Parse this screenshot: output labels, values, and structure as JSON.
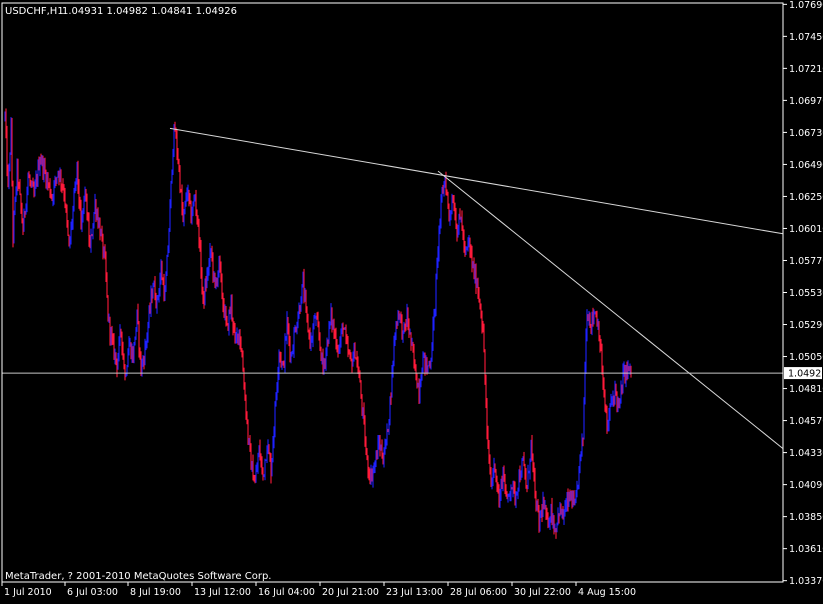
{
  "header": {
    "symbol_label": "USDCHF,H1",
    "ohlc_values": "1.04931 1.04982 1.04841 1.04926"
  },
  "footer": {
    "copyright": "MetaTrader, ? 2001-2010 MetaQuotes Software Corp."
  },
  "colors": {
    "background": "#000000",
    "bull_candle": "#1e22ff",
    "bear_candle": "#ff1a3a",
    "axis": "#ffffff",
    "trendline": "#d8d8d8",
    "bid_line": "#c8c8c8",
    "price_tag_bg": "#ffffff",
    "price_tag_text": "#000000"
  },
  "chart_data": {
    "type": "candlestick",
    "symbol": "USDCHF",
    "timeframe": "H1",
    "last_price": "1.04926",
    "x_tick_labels": [
      "1 Jul 2010",
      "6 Jul 03:00",
      "8 Jul 19:00",
      "13 Jul 12:00",
      "16 Jul 04:00",
      "20 Jul 21:00",
      "23 Jul 13:00",
      "28 Jul 06:00",
      "30 Jul 22:00",
      "4 Aug 15:00"
    ],
    "y_tick_labels": [
      "1.07690",
      "1.07450",
      "1.07210",
      "1.06970",
      "1.06730",
      "1.06490",
      "1.06250",
      "1.06010",
      "1.05770",
      "1.05530",
      "1.05290",
      "1.05050",
      "1.04810",
      "1.04570",
      "1.04330",
      "1.04090",
      "1.03850",
      "1.03610",
      "1.03370"
    ],
    "ylim": [
      1.0336,
      1.077
    ],
    "close_path": [
      [
        0,
        1.0685
      ],
      [
        3,
        1.063
      ],
      [
        6,
        1.0675
      ],
      [
        8,
        1.0595
      ],
      [
        12,
        1.0645
      ],
      [
        18,
        1.06
      ],
      [
        23,
        1.064
      ],
      [
        29,
        1.0625
      ],
      [
        35,
        1.0655
      ],
      [
        41,
        1.064
      ],
      [
        47,
        1.0625
      ],
      [
        53,
        1.0645
      ],
      [
        59,
        1.063
      ],
      [
        64,
        1.0585
      ],
      [
        68,
        1.0615
      ],
      [
        72,
        1.0645
      ],
      [
        76,
        1.06
      ],
      [
        80,
        1.063
      ],
      [
        85,
        1.0585
      ],
      [
        90,
        1.062
      ],
      [
        95,
        1.06
      ],
      [
        100,
        1.0575
      ],
      [
        103,
        1.0535
      ],
      [
        107,
        1.0515
      ],
      [
        112,
        1.05
      ],
      [
        116,
        1.0525
      ],
      [
        120,
        1.049
      ],
      [
        124,
        1.0515
      ],
      [
        128,
        1.0505
      ],
      [
        132,
        1.0535
      ],
      [
        136,
        1.0495
      ],
      [
        140,
        1.051
      ],
      [
        144,
        1.0535
      ],
      [
        148,
        1.056
      ],
      [
        152,
        1.0545
      ],
      [
        156,
        1.057
      ],
      [
        160,
        1.055
      ],
      [
        164,
        1.06
      ],
      [
        168,
        1.0665
      ],
      [
        170,
        1.0675
      ],
      [
        174,
        1.0645
      ],
      [
        178,
        1.0605
      ],
      [
        182,
        1.063
      ],
      [
        186,
        1.061
      ],
      [
        190,
        1.0625
      ],
      [
        194,
        1.0595
      ],
      [
        198,
        1.0545
      ],
      [
        202,
        1.0565
      ],
      [
        206,
        1.0585
      ],
      [
        210,
        1.0555
      ],
      [
        214,
        1.0575
      ],
      [
        218,
        1.0545
      ],
      [
        222,
        1.0525
      ],
      [
        226,
        1.0545
      ],
      [
        230,
        1.0515
      ],
      [
        234,
        1.0525
      ],
      [
        237,
        1.0505
      ],
      [
        240,
        1.0475
      ],
      [
        243,
        1.0445
      ],
      [
        246,
        1.0425
      ],
      [
        250,
        1.041
      ],
      [
        254,
        1.0435
      ],
      [
        258,
        1.0415
      ],
      [
        262,
        1.044
      ],
      [
        266,
        1.042
      ],
      [
        270,
        1.0465
      ],
      [
        274,
        1.051
      ],
      [
        278,
        1.0495
      ],
      [
        282,
        1.053
      ],
      [
        286,
        1.0505
      ],
      [
        290,
        1.0525
      ],
      [
        294,
        1.054
      ],
      [
        298,
        1.056
      ],
      [
        302,
        1.053
      ],
      [
        306,
        1.0515
      ],
      [
        310,
        1.0535
      ],
      [
        314,
        1.052
      ],
      [
        318,
        1.0495
      ],
      [
        322,
        1.0515
      ],
      [
        326,
        1.0535
      ],
      [
        330,
        1.052
      ],
      [
        334,
        1.051
      ],
      [
        338,
        1.053
      ],
      [
        342,
        1.051
      ],
      [
        346,
        1.05
      ],
      [
        350,
        1.051
      ],
      [
        354,
        1.049
      ],
      [
        358,
        1.046
      ],
      [
        362,
        1.0425
      ],
      [
        366,
        1.0415
      ],
      [
        370,
        1.0425
      ],
      [
        374,
        1.044
      ],
      [
        378,
        1.043
      ],
      [
        382,
        1.0445
      ],
      [
        386,
        1.048
      ],
      [
        390,
        1.0525
      ],
      [
        394,
        1.054
      ],
      [
        398,
        1.052
      ],
      [
        402,
        1.0535
      ],
      [
        406,
        1.0515
      ],
      [
        410,
        1.0495
      ],
      [
        414,
        1.048
      ],
      [
        418,
        1.0505
      ],
      [
        422,
        1.0495
      ],
      [
        426,
        1.0505
      ],
      [
        430,
        1.0545
      ],
      [
        434,
        1.06
      ],
      [
        437,
        1.0625
      ],
      [
        440,
        1.064
      ],
      [
        444,
        1.061
      ],
      [
        448,
        1.0625
      ],
      [
        452,
        1.06
      ],
      [
        456,
        1.061
      ],
      [
        460,
        1.058
      ],
      [
        464,
        1.059
      ],
      [
        468,
        1.057
      ],
      [
        472,
        1.056
      ],
      [
        476,
        1.054
      ],
      [
        479,
        1.051
      ],
      [
        482,
        1.0445
      ],
      [
        486,
        1.041
      ],
      [
        490,
        1.0425
      ],
      [
        494,
        1.0395
      ],
      [
        498,
        1.042
      ],
      [
        502,
        1.0395
      ],
      [
        506,
        1.041
      ],
      [
        510,
        1.04
      ],
      [
        514,
        1.0415
      ],
      [
        518,
        1.0425
      ],
      [
        522,
        1.0405
      ],
      [
        526,
        1.044
      ],
      [
        530,
        1.04
      ],
      [
        534,
        1.038
      ],
      [
        538,
        1.0395
      ],
      [
        542,
        1.038
      ],
      [
        546,
        1.039
      ],
      [
        550,
        1.0375
      ],
      [
        554,
        1.039
      ],
      [
        558,
        1.0385
      ],
      [
        562,
        1.0395
      ],
      [
        566,
        1.04
      ],
      [
        570,
        1.039
      ],
      [
        574,
        1.042
      ],
      [
        578,
        1.0445
      ],
      [
        580,
        1.05
      ],
      [
        582,
        1.054
      ],
      [
        586,
        1.053
      ],
      [
        590,
        1.054
      ],
      [
        594,
        1.0525
      ],
      [
        598,
        1.0485
      ],
      [
        602,
        1.045
      ],
      [
        606,
        1.047
      ],
      [
        610,
        1.048
      ],
      [
        614,
        1.0465
      ],
      [
        618,
        1.049
      ],
      [
        622,
        1.0495
      ],
      [
        626,
        1.0493
      ]
    ],
    "bull_rate_bias": 0.52,
    "trendlines": [
      {
        "from": {
          "time": "8 Jul",
          "price": 1.0676
        },
        "to": {
          "time": "end",
          "price": 1.0597
        }
      },
      {
        "from": {
          "time": "27 Jul",
          "price": 1.0644
        },
        "to": {
          "time": "end",
          "price": 1.0436
        }
      }
    ],
    "bid_line": 1.04926
  }
}
